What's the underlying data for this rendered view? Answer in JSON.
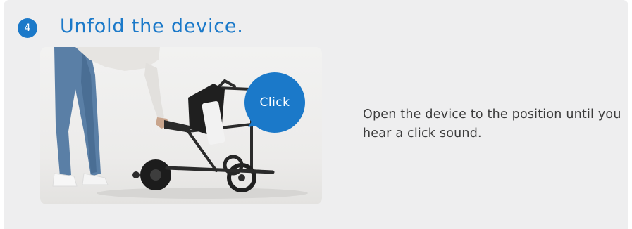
{
  "step": {
    "number": "4",
    "title": "Unfold the device.",
    "callout": "Click",
    "description": "Open the device to the position until you hear a click sound."
  },
  "icons": {
    "photo": "person-unfolding-wheelchair-photo"
  },
  "colors": {
    "accent": "#1b79c9",
    "card_background": "#eeeeef",
    "text": "#3c3c3c"
  }
}
